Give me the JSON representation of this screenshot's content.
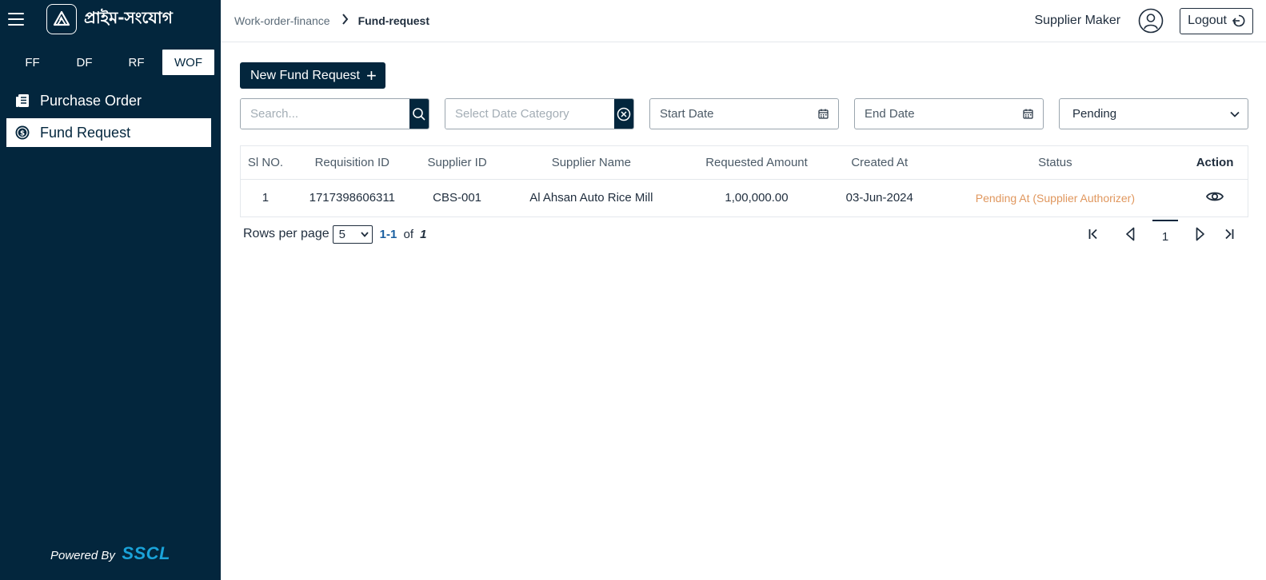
{
  "sidebar": {
    "brand": "প্রাইম-সংযোগ",
    "tabs": [
      {
        "label": "FF"
      },
      {
        "label": "DF"
      },
      {
        "label": "RF"
      },
      {
        "label": "WOF"
      }
    ],
    "nav": [
      {
        "label": "Purchase Order",
        "icon": "document-list-icon"
      },
      {
        "label": "Fund Request",
        "icon": "dollar-coin-icon"
      }
    ],
    "powered_by": "Powered By",
    "powered_brand": "SSCL"
  },
  "header": {
    "breadcrumb": [
      "Work-order-finance",
      "Fund-request"
    ],
    "user": "Supplier Maker",
    "logout_label": "Logout"
  },
  "main": {
    "new_button_label": "New Fund Request",
    "filters": {
      "search_placeholder": "Search...",
      "date_category_placeholder": "Select Date Category",
      "start_date_label": "Start Date",
      "end_date_label": "End Date",
      "status_value": "Pending"
    },
    "table": {
      "columns": [
        "Sl NO.",
        "Requisition ID",
        "Supplier ID",
        "Supplier Name",
        "Requested Amount",
        "Created At",
        "Status",
        "Action"
      ],
      "rows": [
        {
          "sl": "1",
          "requisition_id": "1717398606311",
          "supplier_id": "CBS-001",
          "supplier_name": "Al Ahsan Auto Rice Mill",
          "amount": "1,00,000.00",
          "created_at": "03-Jun-2024",
          "status": "Pending At (Supplier Authorizer)"
        }
      ]
    },
    "pagination": {
      "rows_per_page_label": "Rows per page",
      "rows_per_page": "5",
      "range": "1-1",
      "of": "of",
      "total": "1",
      "current_page": "1"
    }
  },
  "colors": {
    "sidebar_bg": "#03263d",
    "accent": "#03263d",
    "status_pending": "#e0975e",
    "sscl_brand": "#1aa3d9"
  }
}
